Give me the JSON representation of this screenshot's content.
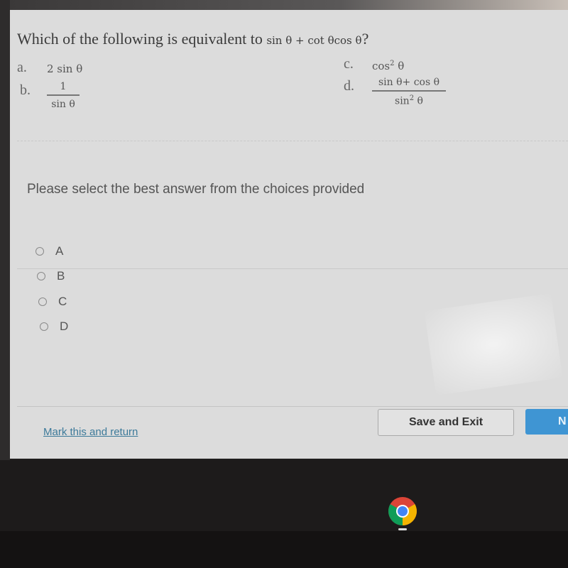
{
  "question": {
    "text": "Which of the following is equivalent to",
    "expression": "sin θ + cot θcos θ",
    "question_mark": "?"
  },
  "choices": [
    {
      "letter": "a.",
      "expr": "2 sin θ"
    },
    {
      "letter": "b.",
      "numerator": "1",
      "denominator": "sin θ"
    },
    {
      "letter": "c.",
      "base": "cos",
      "exponent": "2",
      "var": "θ"
    },
    {
      "letter": "d.",
      "numerator": "sin θ+ cos θ",
      "den_base": "sin",
      "den_exponent": "2",
      "den_var": "θ"
    }
  ],
  "prompt": "Please select the best answer from the choices provided",
  "options": [
    {
      "label": "A",
      "selected": false
    },
    {
      "label": "B",
      "selected": false
    },
    {
      "label": "C",
      "selected": false
    },
    {
      "label": "D",
      "selected": false
    }
  ],
  "footer": {
    "mark_link": "Mark this and return",
    "save_button": "Save and Exit",
    "next_button": "N"
  },
  "taskbar": {
    "apps": [
      {
        "name": "Google Chrome",
        "icon": "chrome-icon"
      }
    ]
  },
  "colors": {
    "accent": "#3f95d3",
    "link": "#3d7a9a"
  }
}
